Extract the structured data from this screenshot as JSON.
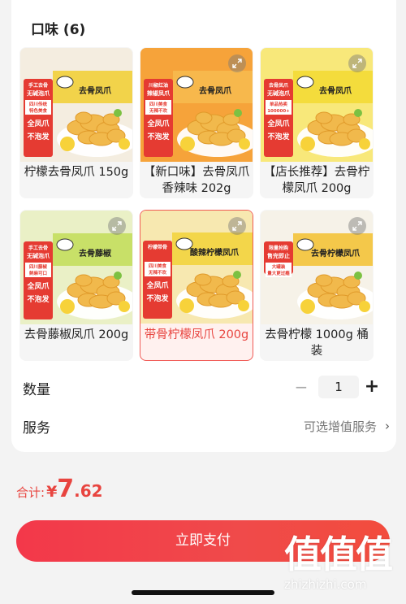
{
  "flavors": {
    "title": "口味 (6)",
    "items": [
      {
        "label": "柠檬去骨凤爪 150g",
        "selected": false
      },
      {
        "label": "【新口味】去骨凤爪香辣味 202g",
        "selected": false
      },
      {
        "label": "【店长推荐】去骨柠檬凤爪 200g",
        "selected": false
      },
      {
        "label": "去骨藤椒凤爪 200g",
        "selected": false
      },
      {
        "label": "带骨柠檬凤爪 200g",
        "selected": true
      },
      {
        "label": "去骨柠檬 1000g 桶装",
        "selected": false
      }
    ],
    "thumbs": [
      {
        "bg": "#f4ede0",
        "band": "#f2d34a",
        "badge_top": "手工去骨",
        "badge_mid": "无碱泡爪",
        "badge_sub": "四川传统特色美食",
        "badge_big": "全凤爪不泡发",
        "box_text": "去骨凤爪"
      },
      {
        "bg": "#f6a33a",
        "band": "#f7b84c",
        "badge_top": "川椒红油",
        "badge_mid": "辣椒凤爪",
        "badge_sub": "四川美食无辣不欢",
        "badge_big": "全凤爪不泡发",
        "box_text": "去骨凤爪"
      },
      {
        "bg": "#f8e87a",
        "band": "#f4dc3c",
        "badge_top": "去骨凤爪",
        "badge_mid": "无碱泡爪",
        "badge_sub": "单品热卖100000+",
        "badge_big": "全凤爪不泡发",
        "box_text": "去骨凤爪"
      },
      {
        "bg": "#eaf0c6",
        "band": "#c8e068",
        "badge_top": "手工去骨",
        "badge_mid": "无碱泡爪",
        "badge_sub": "四川藤椒鲜麻可口",
        "badge_big": "全凤爪不泡发",
        "box_text": "去骨藤椒"
      },
      {
        "bg": "#f7e8b0",
        "band": "#f3d64a",
        "badge_top": "柠檬带骨",
        "badge_mid": "",
        "badge_sub": "四川美食无辣不欢",
        "badge_big": "全凤爪不泡发",
        "box_text": "酸辣柠檬凤爪"
      },
      {
        "bg": "#f6f2e8",
        "band": "#f4c84a",
        "badge_top": "限量抢购",
        "badge_mid": "售完即止",
        "badge_sub": "大罐装 量大更过瘾",
        "badge_big": "",
        "box_text": "去骨柠檬凤爪"
      }
    ]
  },
  "quantity": {
    "label": "数量",
    "minus": "−",
    "value": "1",
    "plus": "+"
  },
  "service": {
    "label": "服务",
    "value": "可选增值服务",
    "chevron": "›"
  },
  "total": {
    "label": "合计:",
    "currency": "¥",
    "integer": "7",
    "decimal": ".62"
  },
  "pay_button": {
    "label": "立即支付"
  },
  "watermark": {
    "logo": "值值值",
    "text": "zhizhizhi.com"
  },
  "colors": {
    "accent": "#e8443f",
    "button": "#f04049"
  },
  "icons": {
    "expand": "expand-icon",
    "minus": "minus-icon",
    "plus": "plus-icon",
    "chevron": "chevron-right-icon"
  }
}
